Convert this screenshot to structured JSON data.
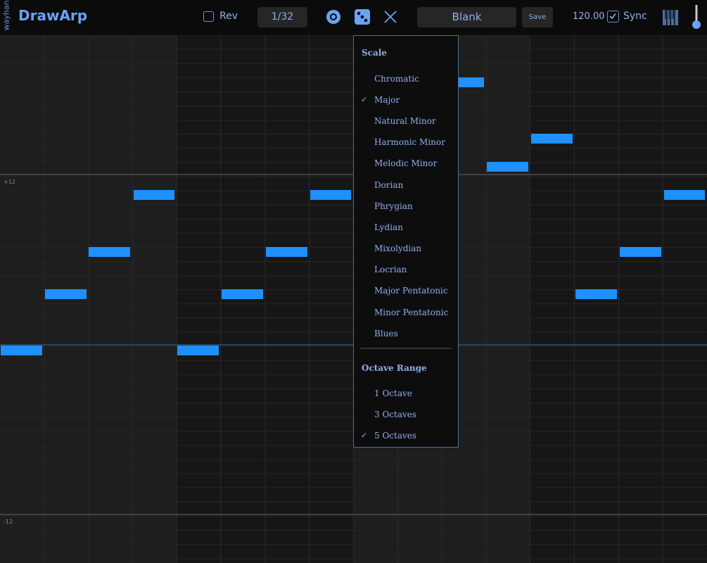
{
  "toolbar": {
    "vendor": "wayhan",
    "title": "DrawArp",
    "rev_label": "Rev",
    "rev_checked": false,
    "division": "1/32",
    "preset": "Blank",
    "save_label": "Save",
    "bpm": "120.00",
    "sync_label": "Sync",
    "sync_checked": true,
    "icons": [
      "record-circle-icon",
      "dice-icon",
      "clear-x-icon",
      "piano-keys-icon",
      "volume-slider-icon"
    ]
  },
  "grid": {
    "octave_labels": [
      "+12",
      "-12"
    ],
    "accent_color": "#1e90ff"
  },
  "menu": {
    "scale_header": "Scale",
    "scales": [
      {
        "label": "Chromatic",
        "checked": false
      },
      {
        "label": "Major",
        "checked": true
      },
      {
        "label": "Natural Minor",
        "checked": false
      },
      {
        "label": "Harmonic Minor",
        "checked": false
      },
      {
        "label": "Melodic Minor",
        "checked": false
      },
      {
        "label": "Dorian",
        "checked": false
      },
      {
        "label": "Phrygian",
        "checked": false
      },
      {
        "label": "Lydian",
        "checked": false
      },
      {
        "label": "Mixolydian",
        "checked": false
      },
      {
        "label": "Locrian",
        "checked": false
      },
      {
        "label": "Major Pentatonic",
        "checked": false
      },
      {
        "label": "Minor Pentatonic",
        "checked": false
      },
      {
        "label": "Blues",
        "checked": false
      }
    ],
    "octave_header": "Octave Range",
    "octaves": [
      {
        "label": "1 Octave",
        "checked": false
      },
      {
        "label": "3 Octaves",
        "checked": false
      },
      {
        "label": "5 Octaves",
        "checked": true
      }
    ],
    "check_mark": "✓"
  }
}
